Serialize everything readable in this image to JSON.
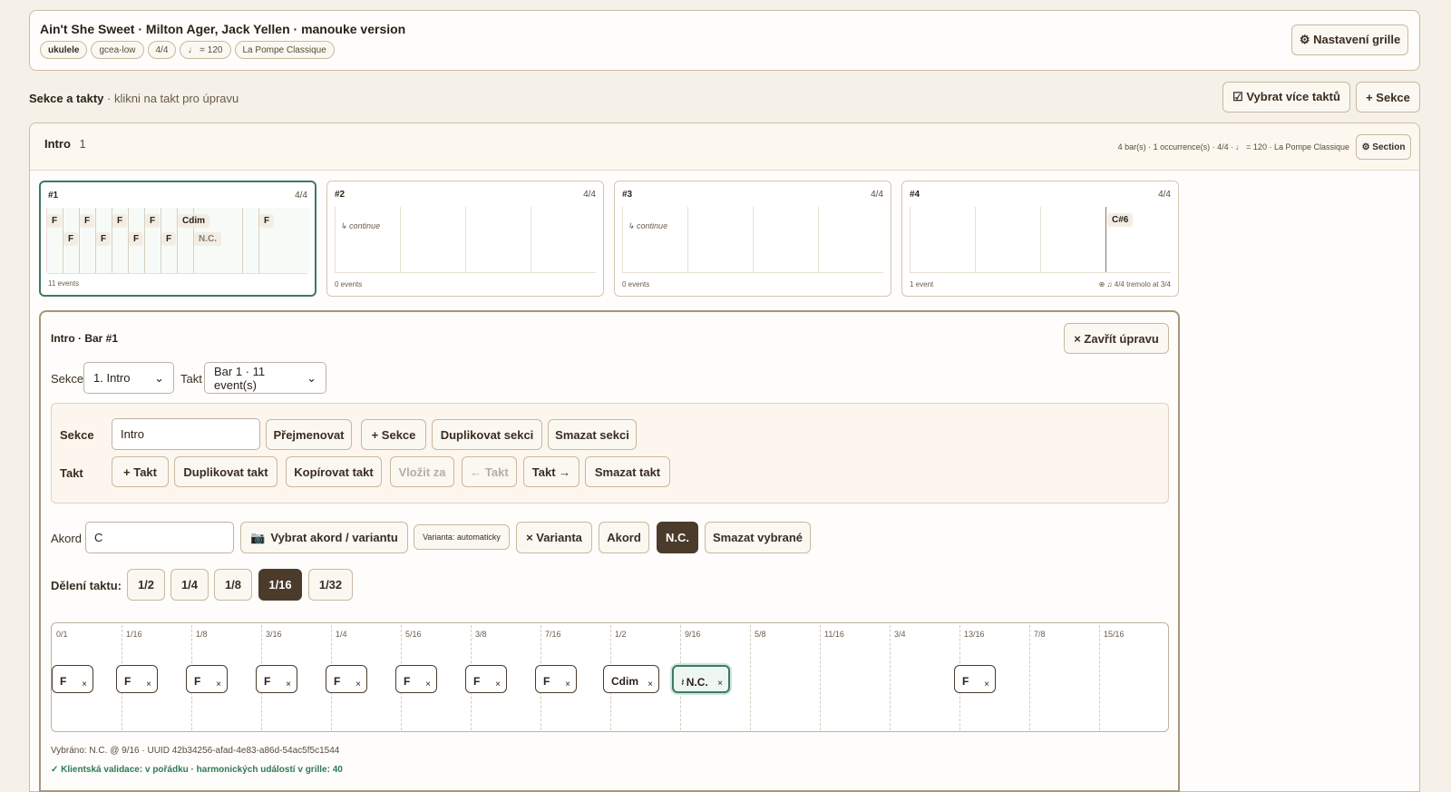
{
  "header": {
    "title": "Ain't She Sweet · Milton Ager, Jack Yellen · manouke version",
    "tags": [
      "ukulele",
      "gcea-low",
      "4/4",
      "♩ = 120",
      "La Pompe Classique"
    ],
    "settings_button": "⚙ Nastavení grille"
  },
  "sections_bar": {
    "title": "Sekce a takty",
    "hint": "· klikni na takt pro úpravu",
    "select_multiple": "☑ Vybrat více taktů",
    "add_section": "+ Sekce"
  },
  "section": {
    "name": "Intro",
    "index": "1",
    "meta": "4 bar(s) · 1 occurrence(s) · 4/4 · ♩ = 120 · La Pompe Classique",
    "button": "⚙ Section"
  },
  "bars": [
    {
      "num": "#1",
      "ts": "4/4",
      "count": "11 events",
      "chips": [
        "F",
        "F",
        "F",
        "F",
        "F",
        "F",
        "F",
        "F",
        "Cdim",
        "N.C.",
        "F"
      ]
    },
    {
      "num": "#2",
      "ts": "4/4",
      "count": "0 events",
      "continue": "↳ continue"
    },
    {
      "num": "#3",
      "ts": "4/4",
      "count": "0 events",
      "continue": "↳ continue"
    },
    {
      "num": "#4",
      "ts": "4/4",
      "count": "1 event",
      "chip": "C#6",
      "extra": "⊕ ♫ 4/4 tremolo at 3/4"
    }
  ],
  "editor": {
    "title": "Intro · Bar #1",
    "close": "× Zavřít úpravu",
    "section_label": "Sekce",
    "section_value": "1. Intro",
    "bar_label": "Takt",
    "bar_value": "Bar 1 · 11 event(s)",
    "row_section": {
      "label": "Sekce",
      "input": "Intro",
      "buttons": [
        "Přejmenovat",
        "+ Sekce",
        "Duplikovat sekci",
        "Smazat sekci"
      ]
    },
    "row_bar": {
      "label": "Takt",
      "buttons": [
        "+ Takt",
        "Duplikovat takt",
        "Kopírovat takt",
        "Vložit za",
        "← Takt",
        "Takt →",
        "Smazat takt"
      ]
    },
    "chord_label": "Akord",
    "chord_value": "C",
    "pick_chord": "Vybrat akord / variantu",
    "variant_auto": "Varianta: automaticky",
    "variant_btn": "× Varianta",
    "chord_btn": "Akord",
    "nc_btn": "N.C.",
    "delete_btn": "Smazat vybrané",
    "division_label": "Dělení taktu:",
    "divisions": [
      "1/2",
      "1/4",
      "1/8",
      "1/16",
      "1/32"
    ],
    "division_active": "1/16",
    "grid_labels": [
      "0/1",
      "1/16",
      "1/8",
      "3/16",
      "1/4",
      "5/16",
      "3/8",
      "7/16",
      "1/2",
      "9/16",
      "5/8",
      "11/16",
      "3/4",
      "13/16",
      "7/8",
      "15/16"
    ],
    "events": [
      "F",
      "F",
      "F",
      "F",
      "F",
      "F",
      "F",
      "F",
      "Cdim",
      "N.C.",
      "F"
    ],
    "remove_symbol": "×",
    "selected_info": "Vybráno: N.C. @ 9/16 · UUID 42b34256-afad-4e83-a86d-54ac5f5c1544",
    "validation": "✓ Klientská validace: v pořádku · harmonických událostí v grille: 40"
  }
}
